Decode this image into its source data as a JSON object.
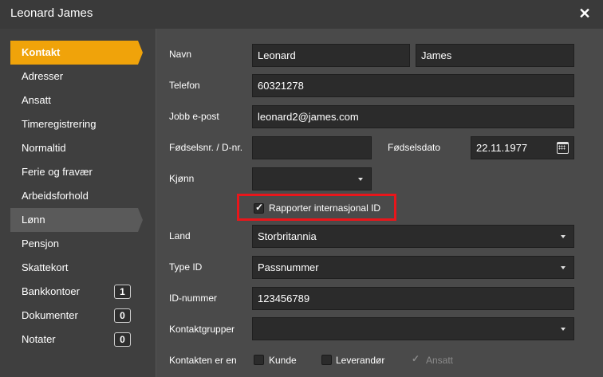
{
  "window": {
    "title": "Leonard James"
  },
  "sidebar": {
    "items": [
      {
        "label": "Kontakt"
      },
      {
        "label": "Adresser"
      },
      {
        "label": "Ansatt"
      },
      {
        "label": "Timeregistrering"
      },
      {
        "label": "Normaltid"
      },
      {
        "label": "Ferie og fravær"
      },
      {
        "label": "Arbeidsforhold"
      },
      {
        "label": "Lønn"
      },
      {
        "label": "Pensjon"
      },
      {
        "label": "Skattekort"
      },
      {
        "label": "Bankkontoer",
        "badge": "1"
      },
      {
        "label": "Dokumenter",
        "badge": "0"
      },
      {
        "label": "Notater",
        "badge": "0"
      }
    ]
  },
  "form": {
    "navn": {
      "label": "Navn",
      "first": "Leonard",
      "last": "James"
    },
    "telefon": {
      "label": "Telefon",
      "value": "60321278"
    },
    "epost": {
      "label": "Jobb e-post",
      "value": "leonard2@james.com"
    },
    "fodselsnr": {
      "label": "Fødselsnr. / D-nr.",
      "value": ""
    },
    "fodselsdato": {
      "label": "Fødselsdato",
      "value": "22.11.1977"
    },
    "kjonn": {
      "label": "Kjønn",
      "value": ""
    },
    "rapporter": {
      "label": "Rapporter internasjonal ID",
      "checked": true
    },
    "land": {
      "label": "Land",
      "value": "Storbritannia"
    },
    "typeid": {
      "label": "Type ID",
      "value": "Passnummer"
    },
    "idnummer": {
      "label": "ID-nummer",
      "value": "123456789"
    },
    "kontaktgrupper": {
      "label": "Kontaktgrupper",
      "value": ""
    },
    "kontakttype": {
      "label": "Kontakten er en",
      "options": [
        {
          "label": "Kunde",
          "checked": false
        },
        {
          "label": "Leverandør",
          "checked": false
        },
        {
          "label": "Ansatt",
          "checked": true,
          "disabled": true
        }
      ]
    }
  },
  "colors": {
    "accent": "#f0a30a",
    "highlight": "#e8161b"
  }
}
